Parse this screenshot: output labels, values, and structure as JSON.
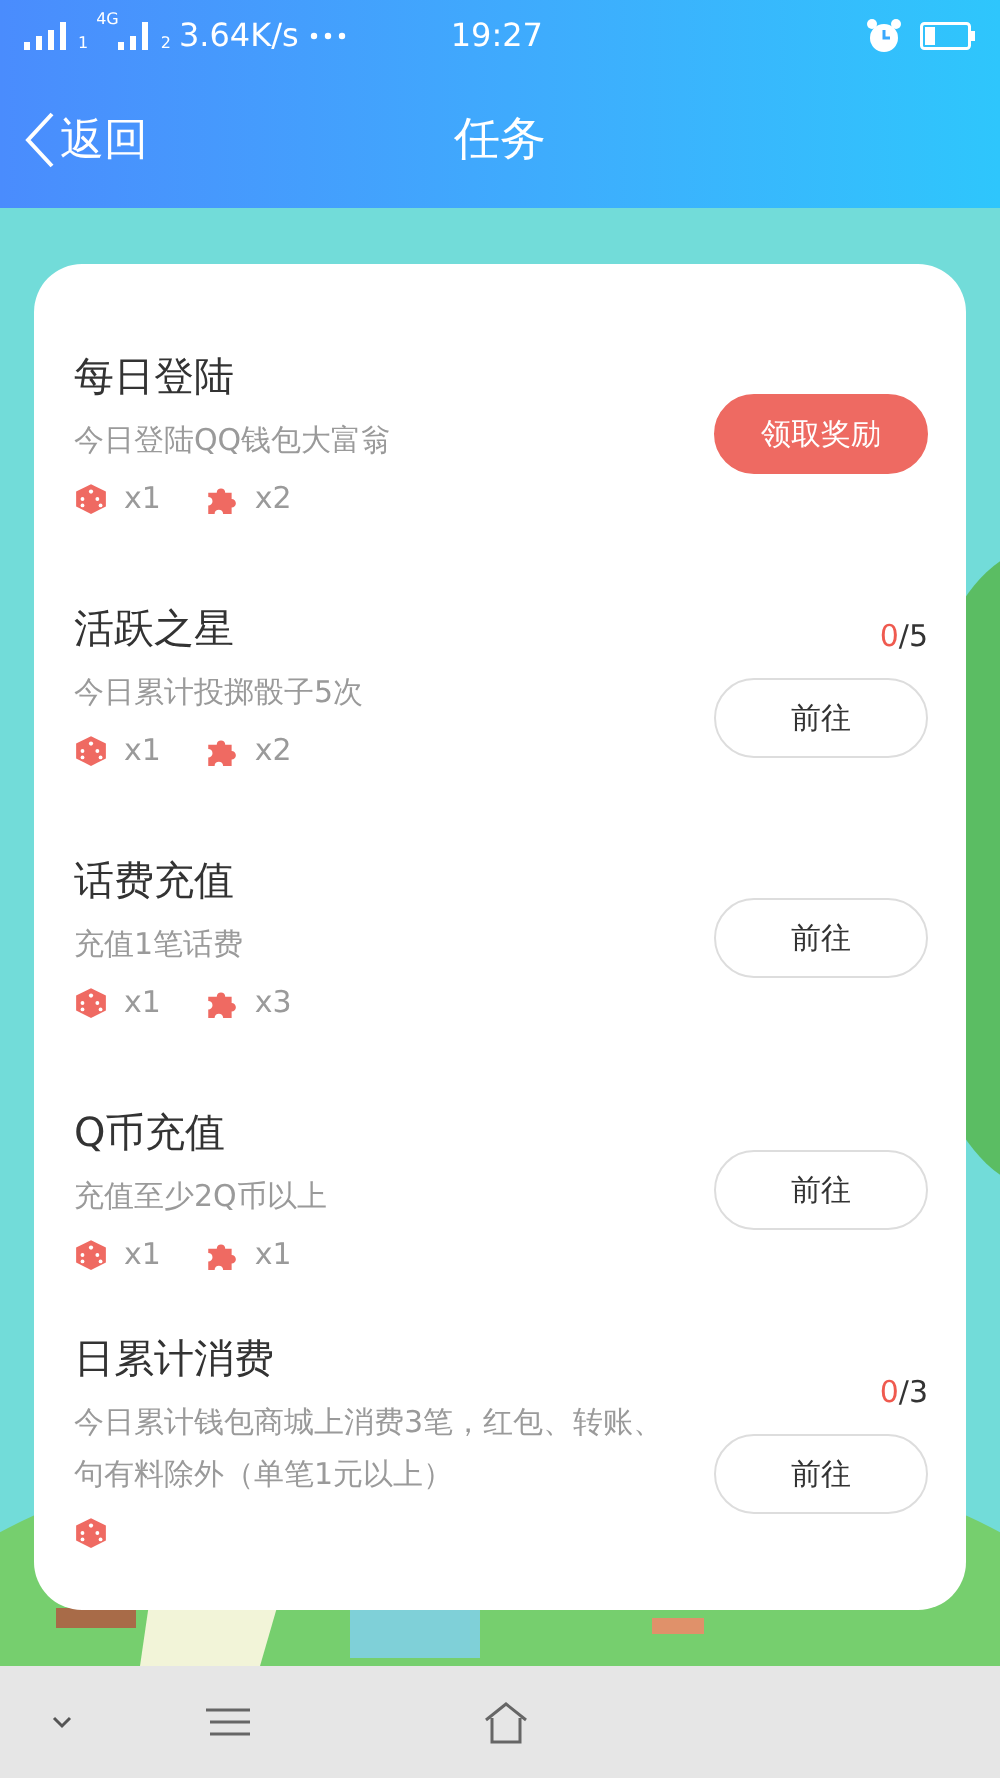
{
  "status_bar": {
    "sim_1": "1",
    "network": "4G",
    "sim_2": "2",
    "speed": "3.64K/s",
    "time": "19:27"
  },
  "header": {
    "back": "返回",
    "title": "任务"
  },
  "tasks": [
    {
      "title": "每日登陆",
      "description": "今日登陆QQ钱包大富翁",
      "rewards": [
        {
          "kind": "dice",
          "count": "x1"
        },
        {
          "kind": "puzzle",
          "count": "x2"
        }
      ],
      "action": {
        "label": "领取奖励",
        "kind": "claim"
      }
    },
    {
      "title": "活跃之星",
      "description": "今日累计投掷骰子5次",
      "progress": {
        "current": "0",
        "total": "/5"
      },
      "rewards": [
        {
          "kind": "dice",
          "count": "x1"
        },
        {
          "kind": "puzzle",
          "count": "x2"
        }
      ],
      "action": {
        "label": "前往",
        "kind": "go"
      }
    },
    {
      "title": "话费充值",
      "description": "充值1笔话费",
      "rewards": [
        {
          "kind": "dice",
          "count": "x1"
        },
        {
          "kind": "puzzle",
          "count": "x3"
        }
      ],
      "action": {
        "label": "前往",
        "kind": "go"
      }
    },
    {
      "title": "Q币充值",
      "description": "充值至少2Q币以上",
      "rewards": [
        {
          "kind": "dice",
          "count": "x1"
        },
        {
          "kind": "puzzle",
          "count": "x1"
        }
      ],
      "action": {
        "label": "前往",
        "kind": "go"
      }
    },
    {
      "title": "日累计消费",
      "description": "今日累计钱包商城上消费3笔，红包、转账、句有料除外（单笔1元以上）",
      "progress": {
        "current": "0",
        "total": "/3"
      },
      "rewards": [
        {
          "kind": "dice"
        }
      ],
      "action": {
        "label": "前往",
        "kind": "go"
      }
    }
  ]
}
